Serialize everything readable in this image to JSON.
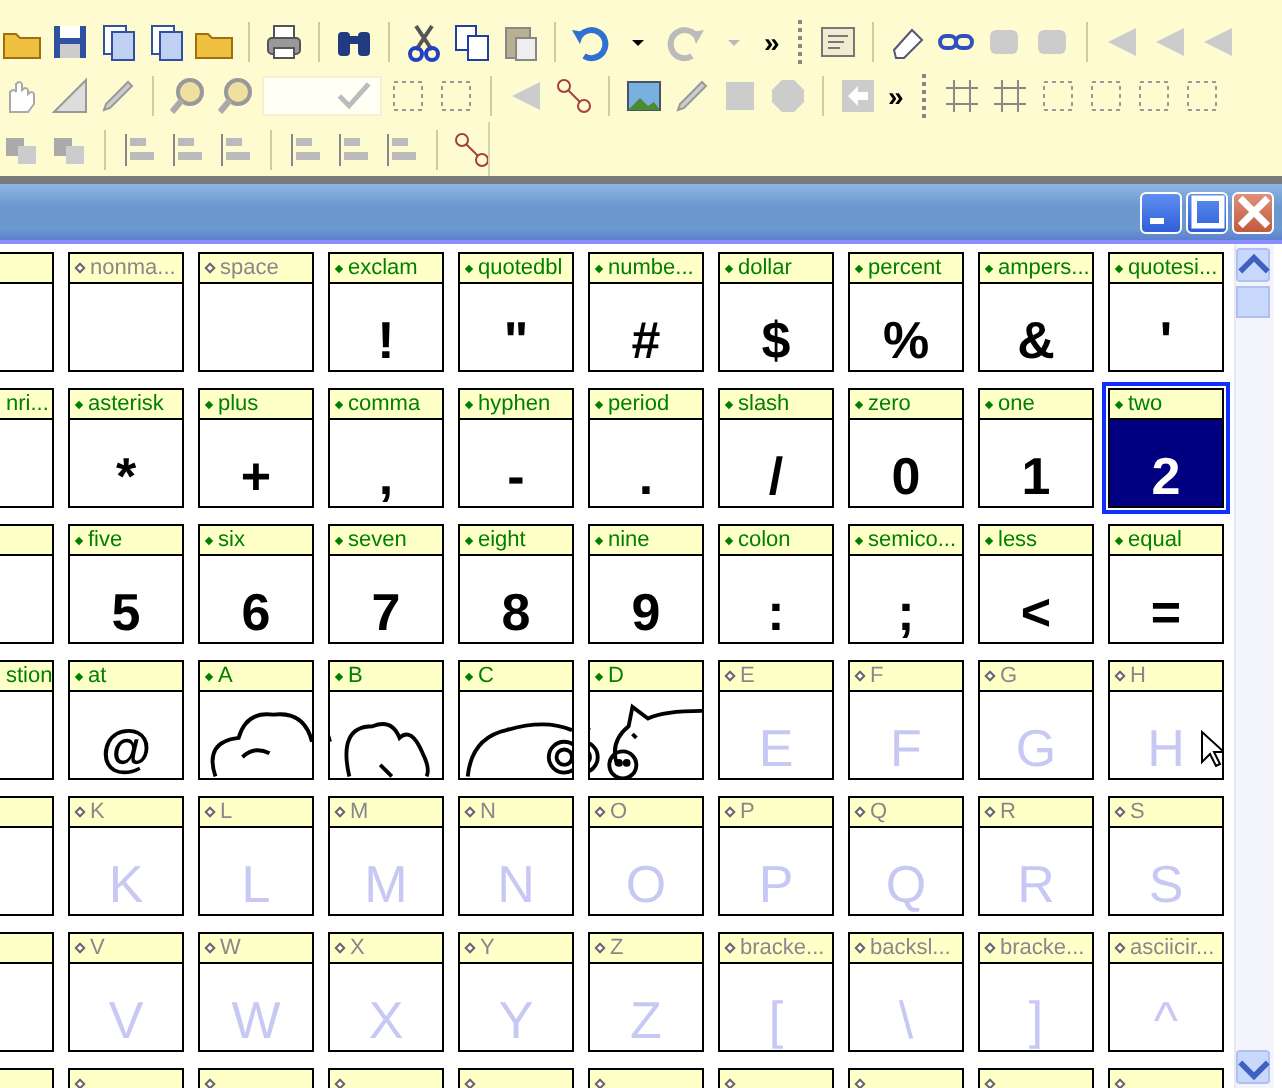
{
  "toolbar": {
    "overflow": [
      "»",
      "»"
    ]
  },
  "grid": {
    "rows": [
      {
        "cells": [
          {
            "kind": "partial",
            "selected": false
          },
          {
            "kind": "empty",
            "label": "nonma...",
            "defined": false,
            "selected": false
          },
          {
            "kind": "empty",
            "label": "space",
            "defined": false,
            "selected": false
          },
          {
            "kind": "char",
            "label": "exclam",
            "glyph": "!",
            "defined": true,
            "selected": false
          },
          {
            "kind": "char",
            "label": "quotedbl",
            "glyph": "\"",
            "defined": true,
            "selected": false
          },
          {
            "kind": "char",
            "label": "numbe...",
            "glyph": "#",
            "defined": true,
            "selected": false
          },
          {
            "kind": "char",
            "label": "dollar",
            "glyph": "$",
            "defined": true,
            "selected": false
          },
          {
            "kind": "char",
            "label": "percent",
            "glyph": "%",
            "defined": true,
            "selected": false
          },
          {
            "kind": "char",
            "label": "ampers...",
            "glyph": "&",
            "defined": true,
            "selected": false
          },
          {
            "kind": "char",
            "label": "quotesi...",
            "glyph": "'",
            "defined": true,
            "selected": false
          }
        ]
      },
      {
        "cells": [
          {
            "kind": "partial",
            "label": "nri...",
            "defined": true,
            "selected": false
          },
          {
            "kind": "char",
            "label": "asterisk",
            "glyph": "*",
            "defined": true,
            "selected": false
          },
          {
            "kind": "char",
            "label": "plus",
            "glyph": "+",
            "defined": true,
            "selected": false
          },
          {
            "kind": "char",
            "label": "comma",
            "glyph": ",",
            "defined": true,
            "selected": false
          },
          {
            "kind": "char",
            "label": "hyphen",
            "glyph": "-",
            "defined": true,
            "selected": false
          },
          {
            "kind": "char",
            "label": "period",
            "glyph": ".",
            "defined": true,
            "selected": false
          },
          {
            "kind": "char",
            "label": "slash",
            "glyph": "/",
            "defined": true,
            "selected": false
          },
          {
            "kind": "char",
            "label": "zero",
            "glyph": "0",
            "defined": true,
            "selected": false
          },
          {
            "kind": "char",
            "label": "one",
            "glyph": "1",
            "defined": true,
            "selected": false
          },
          {
            "kind": "char",
            "label": "two",
            "glyph": "2",
            "defined": true,
            "selected": true
          }
        ]
      },
      {
        "cells": [
          {
            "kind": "partial",
            "selected": false
          },
          {
            "kind": "char",
            "label": "five",
            "glyph": "5",
            "defined": true,
            "selected": false
          },
          {
            "kind": "char",
            "label": "six",
            "glyph": "6",
            "defined": true,
            "selected": false
          },
          {
            "kind": "char",
            "label": "seven",
            "glyph": "7",
            "defined": true,
            "selected": false
          },
          {
            "kind": "char",
            "label": "eight",
            "glyph": "8",
            "defined": true,
            "selected": false
          },
          {
            "kind": "char",
            "label": "nine",
            "glyph": "9",
            "defined": true,
            "selected": false
          },
          {
            "kind": "char",
            "label": "colon",
            "glyph": ":",
            "defined": true,
            "selected": false
          },
          {
            "kind": "char",
            "label": "semico...",
            "glyph": ";",
            "defined": true,
            "selected": false
          },
          {
            "kind": "char",
            "label": "less",
            "glyph": "<",
            "defined": true,
            "selected": false
          },
          {
            "kind": "char",
            "label": "equal",
            "glyph": "=",
            "defined": true,
            "selected": false
          }
        ]
      },
      {
        "cells": [
          {
            "kind": "partial",
            "label": "stion",
            "defined": true,
            "selected": false
          },
          {
            "kind": "char",
            "label": "at",
            "glyph": "@",
            "defined": true,
            "selected": false
          },
          {
            "kind": "drawing",
            "label": "A",
            "defined": true,
            "selected": false
          },
          {
            "kind": "drawing",
            "label": "B",
            "defined": true,
            "selected": false
          },
          {
            "kind": "drawing",
            "label": "C",
            "defined": true,
            "selected": false
          },
          {
            "kind": "drawing",
            "label": "D",
            "defined": true,
            "selected": false
          },
          {
            "kind": "char",
            "label": "E",
            "glyph": "E",
            "defined": false,
            "selected": false
          },
          {
            "kind": "char",
            "label": "F",
            "glyph": "F",
            "defined": false,
            "selected": false
          },
          {
            "kind": "char",
            "label": "G",
            "glyph": "G",
            "defined": false,
            "selected": false
          },
          {
            "kind": "char",
            "label": "H",
            "glyph": "H",
            "defined": false,
            "selected": false
          }
        ]
      },
      {
        "cells": [
          {
            "kind": "partial",
            "selected": false
          },
          {
            "kind": "char",
            "label": "K",
            "glyph": "K",
            "defined": false,
            "selected": false
          },
          {
            "kind": "char",
            "label": "L",
            "glyph": "L",
            "defined": false,
            "selected": false
          },
          {
            "kind": "char",
            "label": "M",
            "glyph": "M",
            "defined": false,
            "selected": false
          },
          {
            "kind": "char",
            "label": "N",
            "glyph": "N",
            "defined": false,
            "selected": false
          },
          {
            "kind": "char",
            "label": "O",
            "glyph": "O",
            "defined": false,
            "selected": false
          },
          {
            "kind": "char",
            "label": "P",
            "glyph": "P",
            "defined": false,
            "selected": false
          },
          {
            "kind": "char",
            "label": "Q",
            "glyph": "Q",
            "defined": false,
            "selected": false
          },
          {
            "kind": "char",
            "label": "R",
            "glyph": "R",
            "defined": false,
            "selected": false
          },
          {
            "kind": "char",
            "label": "S",
            "glyph": "S",
            "defined": false,
            "selected": false
          }
        ]
      },
      {
        "cells": [
          {
            "kind": "partial",
            "selected": false
          },
          {
            "kind": "char",
            "label": "V",
            "glyph": "V",
            "defined": false,
            "selected": false
          },
          {
            "kind": "char",
            "label": "W",
            "glyph": "W",
            "defined": false,
            "selected": false
          },
          {
            "kind": "char",
            "label": "X",
            "glyph": "X",
            "defined": false,
            "selected": false
          },
          {
            "kind": "char",
            "label": "Y",
            "glyph": "Y",
            "defined": false,
            "selected": false
          },
          {
            "kind": "char",
            "label": "Z",
            "glyph": "Z",
            "defined": false,
            "selected": false
          },
          {
            "kind": "char",
            "label": "bracke...",
            "glyph": "[",
            "defined": false,
            "selected": false
          },
          {
            "kind": "char",
            "label": "backsl...",
            "glyph": "\\",
            "defined": false,
            "selected": false
          },
          {
            "kind": "char",
            "label": "bracke...",
            "glyph": "]",
            "defined": false,
            "selected": false
          },
          {
            "kind": "char",
            "label": "asciicir...",
            "glyph": "^",
            "defined": false,
            "selected": false
          }
        ]
      },
      {
        "cells": [
          {
            "kind": "partial"
          },
          {
            "kind": "cut",
            "defined": false
          },
          {
            "kind": "cut",
            "defined": false
          },
          {
            "kind": "cut",
            "defined": false
          },
          {
            "kind": "cut",
            "defined": false
          },
          {
            "kind": "cut",
            "defined": false
          },
          {
            "kind": "cut",
            "defined": false
          },
          {
            "kind": "cut",
            "defined": false
          },
          {
            "kind": "cut",
            "defined": false
          },
          {
            "kind": "cut",
            "defined": false
          }
        ]
      }
    ]
  }
}
